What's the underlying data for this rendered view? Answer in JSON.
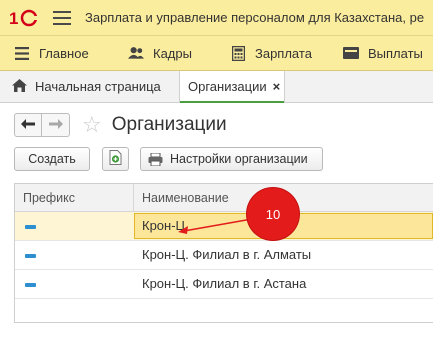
{
  "window": {
    "title": "Зарплата и управление персоналом для Казахстана, ре",
    "logo_icon": "1c-logo-icon",
    "menu_icon": "hamburger-icon"
  },
  "menu": [
    {
      "label": "Главное",
      "icon": "list-icon"
    },
    {
      "label": "Кадры",
      "icon": "people-icon"
    },
    {
      "label": "Зарплата",
      "icon": "calculator-icon"
    },
    {
      "label": "Выплаты",
      "icon": "wallet-icon"
    }
  ],
  "tabs": {
    "home": {
      "label": "Начальная страница",
      "icon": "home-icon"
    },
    "active": {
      "label": "Организации",
      "close": "×"
    }
  },
  "page": {
    "title": "Организации"
  },
  "toolbar": {
    "create_label": "Создать",
    "settings_label": "Настройки организации"
  },
  "table": {
    "columns": [
      "Префикс",
      "Наименование"
    ],
    "rows": [
      {
        "name": "Крон-Ц",
        "selected": true
      },
      {
        "name": "Крон-Ц. Филиал в г. Алматы",
        "selected": false
      },
      {
        "name": "Крон-Ц. Филиал в г. Астана",
        "selected": false
      }
    ]
  },
  "annotation": {
    "label": "10",
    "color": "#e31b1b"
  },
  "colors": {
    "accent_bar": "#fbed9e",
    "active_tab_underline": "#4a9e3f",
    "selection": "#fbe69a",
    "prefix_marker": "#2e8fd0"
  }
}
